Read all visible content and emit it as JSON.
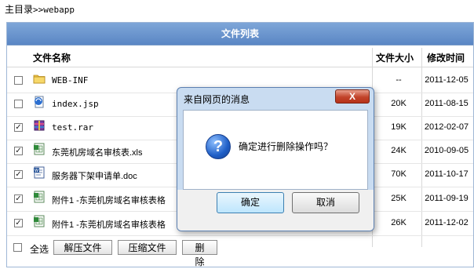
{
  "breadcrumb": {
    "label": "主目录",
    "separator": ">>",
    "path": "webapp"
  },
  "panel": {
    "title": "文件列表"
  },
  "columns": {
    "name": "文件名称",
    "size": "文件大小",
    "date": "修改时间"
  },
  "files": [
    {
      "name": "WEB-INF",
      "size": "--",
      "date": "2011-12-05",
      "checked": false,
      "icon": "folder-icon"
    },
    {
      "name": "index.jsp",
      "size": "20K",
      "date": "2011-08-15",
      "checked": false,
      "icon": "jsp-file-icon"
    },
    {
      "name": "test.rar",
      "size": "19K",
      "date": "2012-02-07",
      "checked": true,
      "icon": "rar-archive-icon"
    },
    {
      "name": "东莞机房域名审核表.xls",
      "size": "24K",
      "date": "2010-09-05",
      "checked": true,
      "icon": "excel-file-icon"
    },
    {
      "name": "服务器下架申请单.doc",
      "size": "70K",
      "date": "2011-10-17",
      "checked": true,
      "icon": "word-file-icon"
    },
    {
      "name": "附件1 -东莞机房域名审核表格",
      "size": "25K",
      "date": "2011-09-19",
      "checked": true,
      "icon": "excel-file-icon"
    },
    {
      "name": "附件1 -东莞机房域名审核表格",
      "size": "26K",
      "date": "2011-12-02",
      "checked": true,
      "icon": "excel-file-icon"
    }
  ],
  "toolbar": {
    "select_all": "全选",
    "extract": "解压文件",
    "compress": "压缩文件",
    "delete": "删 除"
  },
  "dialog": {
    "title": "来自网页的消息",
    "message": "确定进行删除操作吗？",
    "ok": "确定",
    "cancel": "取消",
    "close_glyph": "X"
  },
  "check_glyph": "✓"
}
